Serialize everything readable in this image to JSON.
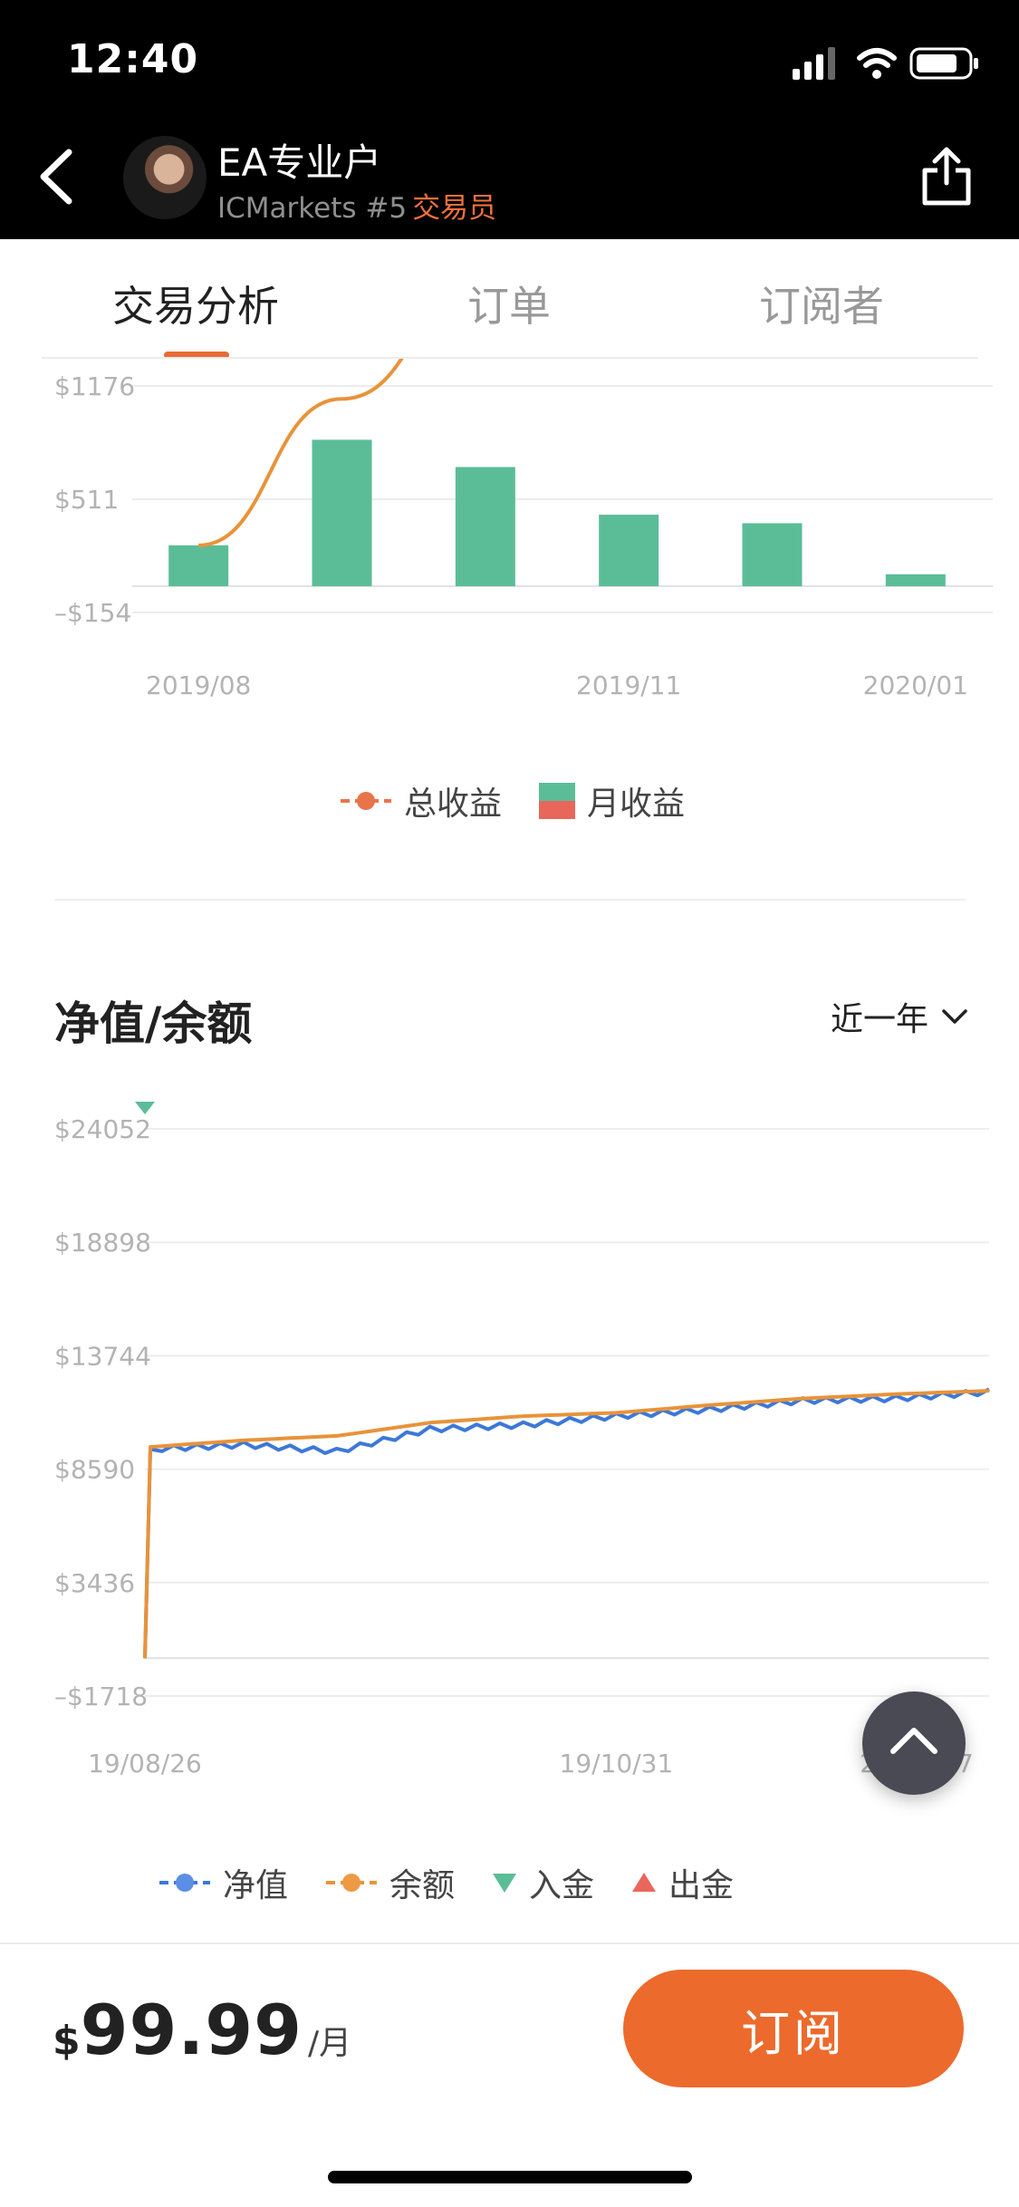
{
  "status": {
    "time": "12:40"
  },
  "header": {
    "account_name": "EA专业户",
    "broker": "ICMarkets #5",
    "role": "交易员"
  },
  "icons": [
    "back-chevron-icon",
    "avatar",
    "share-icon",
    "cellular-signal-icon",
    "wifi-icon",
    "battery-icon",
    "chevron-down-icon",
    "chevron-up-icon"
  ],
  "tabs": [
    {
      "label": "交易分析",
      "active": true
    },
    {
      "label": "订单",
      "active": false
    },
    {
      "label": "订阅者",
      "active": false
    }
  ],
  "colors": {
    "accent": "#ec6a2c",
    "bar_green": "#5bbd97",
    "bar_red": "#e8675a",
    "line_total": "#e8933a",
    "equity_blue": "#3d78d8",
    "balance_orange": "#e8933a"
  },
  "chart_data": [
    {
      "type": "bar",
      "x_tick_labels": [
        "2019/08",
        "2019/11",
        "2020/01"
      ],
      "y_tick_labels": [
        "$1176",
        "$511",
        "–$154"
      ],
      "ylim": [
        -154,
        1176
      ],
      "categories": [
        "2019/08",
        "2019/09",
        "2019/10",
        "2019/11",
        "2019/12",
        "2020/01"
      ],
      "series": [
        {
          "name": "月收益",
          "type": "bar",
          "values": [
            240,
            860,
            700,
            420,
            370,
            70
          ]
        },
        {
          "name": "总收益",
          "type": "line",
          "values": [
            240,
            1100,
            1800,
            null,
            null,
            null
          ]
        }
      ],
      "legend": [
        {
          "label": "总收益",
          "symbol": "line-dot",
          "color": "#e8933a"
        },
        {
          "label": "月收益",
          "symbol": "split-square",
          "colors": [
            "#5bbd97",
            "#e8675a"
          ]
        }
      ],
      "grid": true
    },
    {
      "type": "line",
      "title": "净值/余额",
      "range_label": "近一年",
      "x_tick_labels": [
        "19/08/26",
        "19/10/31",
        "20/01/07"
      ],
      "y_tick_labels": [
        "$24052",
        "$18898",
        "$13744",
        "$8590",
        "$3436",
        "–$1718"
      ],
      "ylim": [
        -1718,
        24052
      ],
      "x": [
        "19/08/26",
        "19/08/27",
        "19/09/10",
        "19/09/20",
        "19/10/05",
        "19/10/20",
        "19/10/31",
        "19/11/20",
        "19/12/10",
        "19/12/25",
        "20/01/07"
      ],
      "series": [
        {
          "name": "净值",
          "values": [
            0,
            9500,
            9700,
            9400,
            10400,
            10600,
            11000,
            11300,
            11700,
            11800,
            12100
          ]
        },
        {
          "name": "余额",
          "values": [
            0,
            9600,
            9900,
            10100,
            10700,
            11000,
            11150,
            11500,
            11800,
            12000,
            12150
          ]
        }
      ],
      "markers": [
        {
          "name": "入金",
          "x": "19/08/26",
          "type": "deposit"
        }
      ],
      "legend": [
        {
          "label": "净值",
          "symbol": "line-dot",
          "color": "#3d78d8"
        },
        {
          "label": "余额",
          "symbol": "line-dot",
          "color": "#e8933a"
        },
        {
          "label": "入金",
          "symbol": "triangle-down",
          "color": "#5bbd97"
        },
        {
          "label": "出金",
          "symbol": "triangle-up",
          "color": "#e8675a"
        }
      ],
      "grid": true
    }
  ],
  "footer": {
    "currency": "$",
    "price": "99.99",
    "unit": "/月",
    "subscribe_label": "订阅"
  }
}
